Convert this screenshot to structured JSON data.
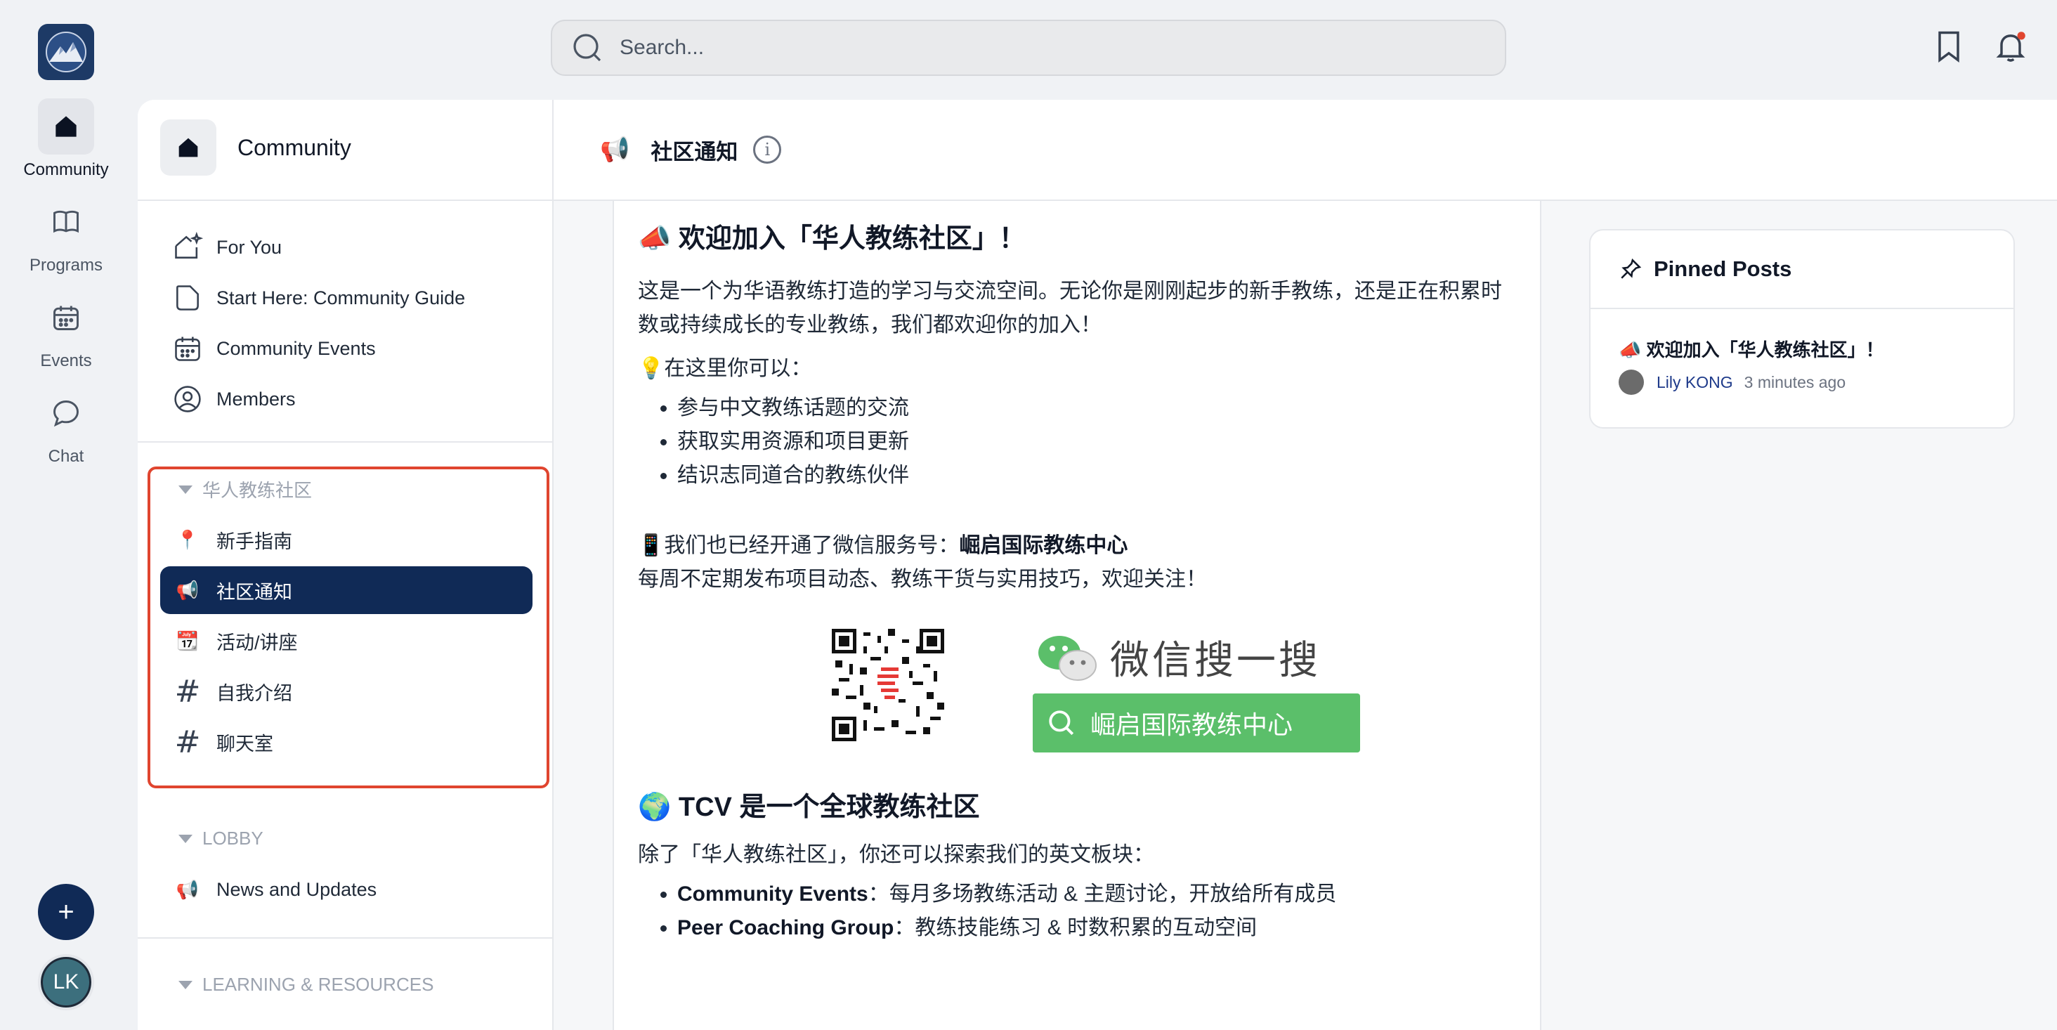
{
  "rail": {
    "items": [
      {
        "label": "Community",
        "icon": "home-icon"
      },
      {
        "label": "Programs",
        "icon": "book-icon"
      },
      {
        "label": "Events",
        "icon": "calendar-icon"
      },
      {
        "label": "Chat",
        "icon": "chat-icon"
      }
    ],
    "add_label": "+",
    "avatar_initials": "LK"
  },
  "search": {
    "placeholder": "Search..."
  },
  "sidebar": {
    "title": "Community",
    "nav": [
      {
        "label": "For You",
        "icon": "sparkle-home-icon"
      },
      {
        "label": "Start Here: Community Guide",
        "icon": "page-icon"
      },
      {
        "label": "Community Events",
        "icon": "calendar-icon"
      },
      {
        "label": "Members",
        "icon": "person-icon"
      }
    ],
    "section1": {
      "label": "华人教练社区",
      "items": [
        {
          "label": "新手指南",
          "icon": "📍"
        },
        {
          "label": "社区通知",
          "icon": "📢"
        },
        {
          "label": "活动/讲座",
          "icon": "📆"
        },
        {
          "label": "自我介绍",
          "icon": "#"
        },
        {
          "label": "聊天室",
          "icon": "#"
        }
      ]
    },
    "section2": {
      "label": "LOBBY",
      "items": [
        {
          "label": "News and Updates",
          "icon": "📢"
        }
      ]
    },
    "section3": {
      "label": "LEARNING & RESOURCES"
    }
  },
  "channel": {
    "title": "社区通知"
  },
  "post": {
    "heading1_emoji": "📣",
    "heading1": "欢迎加入「华人教练社区」！",
    "intro": "这是一个为华语教练打造的学习与交流空间。无论你是刚刚起步的新手教练，还是正在积累时数或持续成长的专业教练，我们都欢迎你的加入！",
    "can_do": "💡在这里你可以：",
    "bullets": [
      "参与中文教练话题的交流",
      "获取实用资源和项目更新",
      "结识志同道合的教练伙伴"
    ],
    "wechat_line_prefix": "📱我们也已经开通了微信服务号：",
    "wechat_name": "崛启国际教练中心",
    "weekly": "每周不定期发布项目动态、教练干货与实用技巧，欢迎关注！",
    "wx_search_label": "微信搜一搜",
    "wx_search_query": "崛启国际教练中心",
    "heading2_emoji": "🌍",
    "heading2": "TCV 是一个全球教练社区",
    "english_intro": "除了「华人教练社区」，你还可以探索我们的英文板块：",
    "english_items": [
      {
        "name": "Community Events",
        "desc": "：每月多场教练活动 & 主题讨论，开放给所有成员"
      },
      {
        "name": "Peer Coaching Group",
        "desc": "：教练技能练习 & 时数积累的互动空间"
      }
    ]
  },
  "pinned": {
    "title": "Pinned Posts",
    "post_title": "📣 欢迎加入「华人教练社区」！",
    "author": "Lily KONG",
    "time": "3 minutes ago"
  },
  "colors": {
    "brand_navy": "#102a56",
    "highlight_red": "#e0452f",
    "wechat_green": "#5bbf6a"
  }
}
